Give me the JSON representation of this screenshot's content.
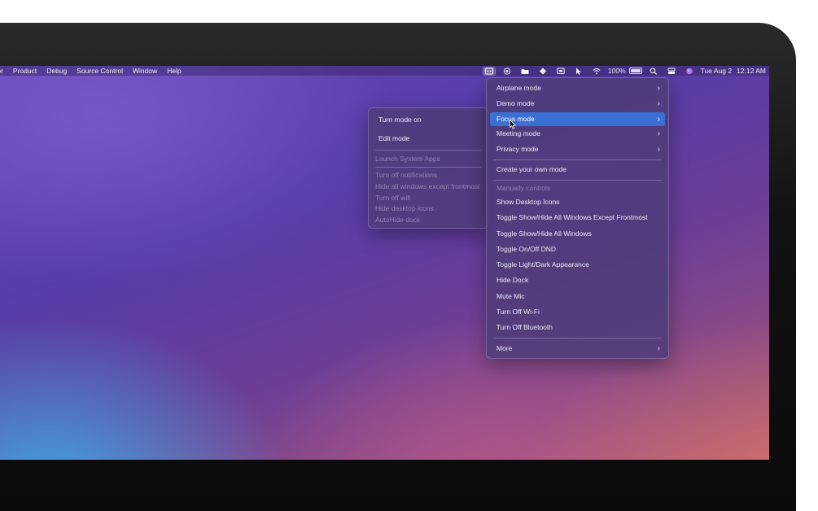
{
  "menubar": {
    "items": [
      "tor",
      "Product",
      "Debug",
      "Source Control",
      "Window",
      "Help"
    ],
    "battery_percent": "100%",
    "date": "Tue Aug 2",
    "time": "12:12 AM"
  },
  "focus_menu": {
    "items": [
      "Airplane mode",
      "Demo mode",
      "Focus mode",
      "Meeting mode",
      "Privacy mode"
    ],
    "create_label": "Create your own mode",
    "section_header": "Manually controls",
    "controls": [
      "Show Desktop Icons",
      "Toggle Show/Hide All Windows Except Frontmost",
      "Toggle Show/Hide All Windows",
      "Toggle On/Off DND",
      "Toggle Light/Dark Appearance",
      "Hide Dock",
      "Mute Mic",
      "Turn Off Wi-Fi",
      "Turn Off Bluetooth"
    ],
    "more_label": "More",
    "chevron": "›",
    "highlight_color": "#3a6fd3"
  },
  "submenu": {
    "actions": [
      "Turn mode on",
      "Edit mode"
    ],
    "section_header": "Launch System Apps",
    "disabled_items": [
      "Turn off notifications",
      "Hide all windows except frontmost",
      "Turn off wifi",
      "Hide desktop icons",
      "AutoHide dock"
    ]
  }
}
